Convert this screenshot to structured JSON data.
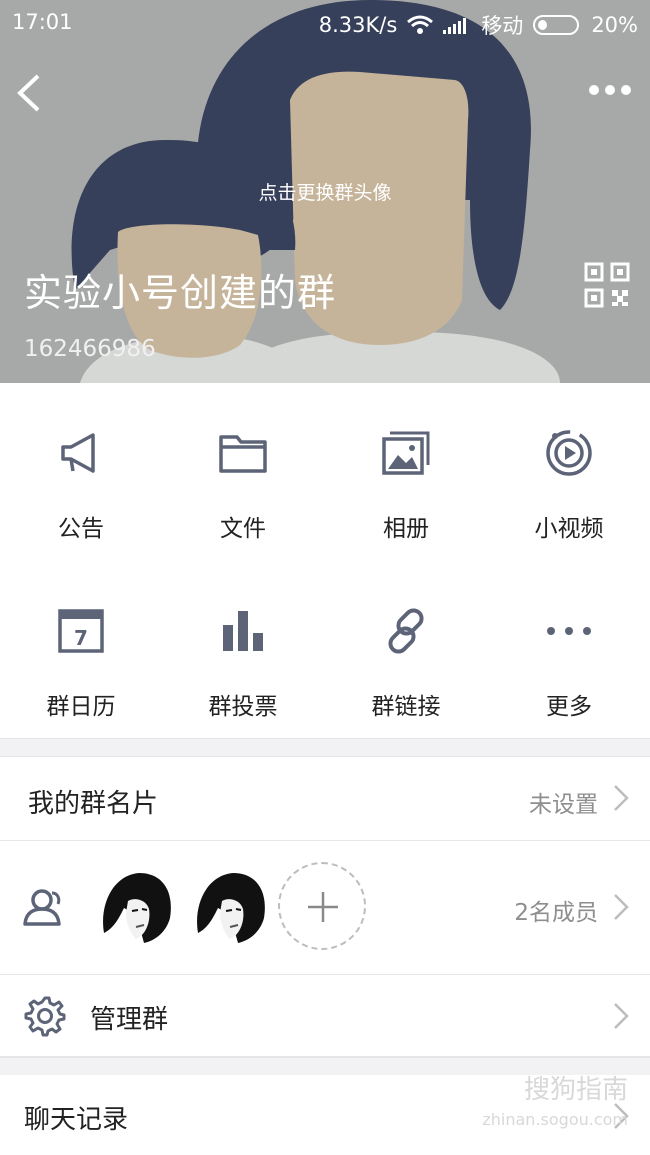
{
  "status_bar": {
    "time": "17:01",
    "speed": "8.33K/s",
    "carrier": "移动",
    "battery": "20%"
  },
  "header": {
    "change_avatar_tip": "点击更换群头像",
    "group_name": "实验小号创建的群",
    "group_id": "162466986"
  },
  "features": [
    {
      "label": "公告",
      "icon": "megaphone-icon"
    },
    {
      "label": "文件",
      "icon": "folder-icon"
    },
    {
      "label": "相册",
      "icon": "album-icon"
    },
    {
      "label": "小视频",
      "icon": "video-icon"
    },
    {
      "label": "群日历",
      "icon": "calendar-icon",
      "calendar_day": "7"
    },
    {
      "label": "群投票",
      "icon": "vote-chart-icon"
    },
    {
      "label": "群链接",
      "icon": "link-icon"
    },
    {
      "label": "更多",
      "icon": "more-icon"
    }
  ],
  "my_card": {
    "title": "我的群名片",
    "value": "未设置"
  },
  "members": {
    "count_label": "2名成员"
  },
  "manage": {
    "title": "管理群"
  },
  "history": {
    "title": "聊天记录"
  },
  "watermark": {
    "text": "搜狗指南",
    "url": "zhinan.sogou.com"
  },
  "colors": {
    "icon": "#5d6478",
    "hair": "#37405a",
    "skin": "#c6b49a",
    "hero_bg": "#a7a9a8"
  }
}
